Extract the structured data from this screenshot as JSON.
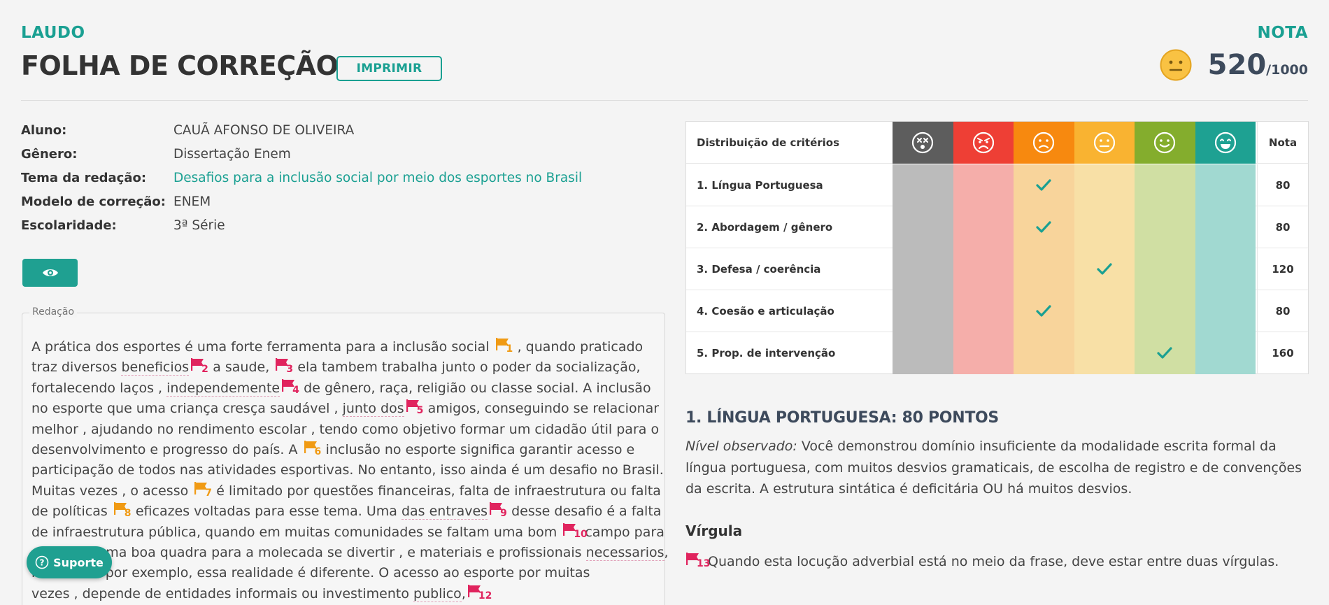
{
  "header": {
    "eyebrow": "LAUDO",
    "title": "FOLHA DE CORREÇÃO",
    "print_label": "IMPRIMIR",
    "grade_eyebrow": "NOTA",
    "grade_value": "520",
    "grade_max": "/1000"
  },
  "info": [
    {
      "label": "Aluno:",
      "value": "CAUÃ AFONSO DE OLIVEIRA"
    },
    {
      "label": "Gênero:",
      "value": "Dissertação Enem"
    },
    {
      "label": "Tema da redação:",
      "value": "Desafios para a inclusão social por meio dos esportes no Brasil"
    },
    {
      "label": "Modelo de correção:",
      "value": "ENEM"
    },
    {
      "label": "Escolaridade:",
      "value": "3ª Série"
    }
  ],
  "essay": {
    "legend": "Redação",
    "lines": [
      {
        "a": "A prática dos esportes é uma forte ferramenta para a inclusão social ",
        "f1": "1",
        "b": " , quando praticado"
      },
      {
        "a": "traz diversos ",
        "u1": "beneficios",
        "f1": "2",
        "b": " a saude, ",
        "f2": "3",
        "c": " ela tambem trabalha junto o poder da socialização,"
      },
      {
        "a": "fortalecendo laços , ",
        "u1": "independemente",
        "f1": "4",
        "b": " de gênero, raça, religião ou classe social. A inclusão"
      },
      {
        "a": "no esporte que uma criança cresça saudável , ",
        "u1": "junto dos",
        "f1": "5",
        "b": " amigos, conseguindo se relacionar"
      },
      {
        "a": "melhor , ajudando no rendimento escolar , tendo como objetivo formar um cidadão útil para o"
      },
      {
        "a": "desenvolvimento e progresso do país. A ",
        "f1": "6",
        "b": " inclusão no esporte significa garantir acesso e"
      },
      {
        "a": "participação de todos nas atividades esportivas. No entanto, isso ainda é um desafio no Brasil."
      },
      {
        "a": "Muitas vezes , o acesso ",
        "f1": "7",
        "b": " é limitado por questões financeiras, falta de infraestrutura ou falta"
      },
      {
        "a": "de políticas ",
        "f1": "8",
        "b": " eficazes voltadas para esse tema. Uma ",
        "u1": "das entraves",
        "f2": "9",
        "c": " desse desafio é a falta"
      },
      {
        "a": "de infraestrutura pública, quando em muitas comunidades se faltam uma bom ",
        "f1": "10",
        "b": " campo para"
      },
      {
        "a": "se jogar , uma boa quadra para a molecada se divertir , e materiais e profissionais ",
        "u1": "necessarios",
        "b": ","
      },
      {
        "a": "     ros nobres por exemplo, essa realidade é diferente. O acesso ao esporte por muitas"
      },
      {
        "a": "vezes , depende de entidades informais ou investimento ",
        "u1": "publico",
        "b": ",",
        "f1": "12"
      }
    ]
  },
  "support_label": "Suporte",
  "criteria": {
    "header_label": "Distribuição de critérios",
    "score_header": "Nota",
    "level_colors": [
      "#5d5d5d",
      "#ee3f35",
      "#f7890f",
      "#f9b331",
      "#84ad2d",
      "#1ea192"
    ],
    "level_bg": [
      "#bbbbbb",
      "#f5aeaa",
      "#f8d49b",
      "#f8e0a6",
      "#d0dfa3",
      "#a1d9d1"
    ],
    "rows": [
      {
        "label": "1. Língua Portuguesa",
        "level": 2,
        "score": "80"
      },
      {
        "label": "2. Abordagem / gênero",
        "level": 2,
        "score": "80"
      },
      {
        "label": "3. Defesa / coerência",
        "level": 3,
        "score": "120"
      },
      {
        "label": "4. Coesão e articulação",
        "level": 2,
        "score": "80"
      },
      {
        "label": "5. Prop. de intervenção",
        "level": 4,
        "score": "160"
      }
    ]
  },
  "section": {
    "title": "1. LÍNGUA PORTUGUESA: 80 PONTOS",
    "observed_label": "Nível observado:",
    "observed_text": " Você demonstrou domínio insuficiente da modalidade escrita formal da língua portuguesa, com muitos desvios gramaticais, de escolha de registro e de convenções da escrita. A estrutura sintática é deficitária OU há muitos desvios.",
    "sub_title": "Vírgula",
    "sub_flag": "13",
    "sub_text": "Quando esta locução adverbial está no meio da frase, deve estar entre duas vírgulas."
  }
}
